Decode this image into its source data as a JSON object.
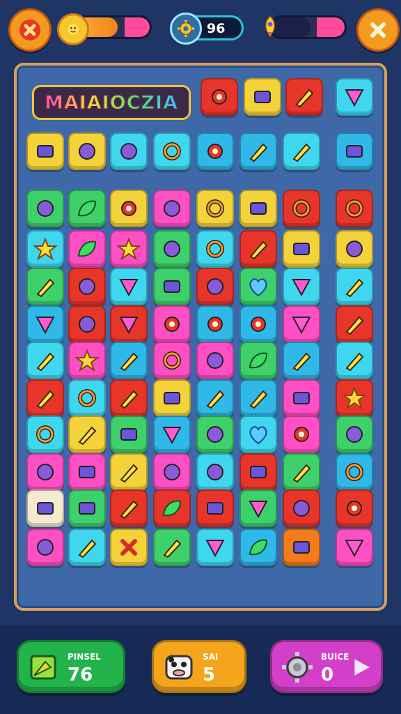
{
  "header": {
    "close_left_icon": "close-icon",
    "close_right_icon": "close-icon",
    "progress_fraction": 0.62,
    "energy_fraction": 0.55,
    "counter_value": "96",
    "colors": {
      "orange": "#f39a1f",
      "pink": "#ff4b9a",
      "teal": "#29c7d8"
    }
  },
  "board": {
    "logo_text": "MAIAIOCZIA"
  },
  "bottom": {
    "left": {
      "label": "PINSEL",
      "value": "76",
      "color": "#22b34a"
    },
    "middle": {
      "label": "SAI",
      "value": "5",
      "color": "#f4a51c"
    },
    "right": {
      "label": "BUICE",
      "value": "0",
      "color": "#d43fc9"
    }
  },
  "tiles": [
    "bug",
    "scroll",
    "red-tube",
    "gem",
    "robot",
    "face",
    "blob",
    "no-sign",
    "gear",
    "wand",
    "pencil",
    "bag",
    "ball",
    "leaf",
    "flower",
    "lolly",
    "swirl",
    "bucket",
    "no-sign",
    "donut",
    "star",
    "pepper",
    "star",
    "ring",
    "squiggle",
    "crayon",
    "box",
    "ring",
    "eraser",
    "ring",
    "pin",
    "m-shape",
    "blob",
    "heart",
    "pin",
    "key",
    "cheese",
    "ring",
    "flag",
    "dots",
    "dots",
    "gear",
    "gem",
    "tube",
    "pencil",
    "star",
    "marker",
    "cc",
    "coin",
    "check",
    "plane",
    "tube",
    "eraser",
    "donut",
    "brush",
    "card",
    "hammer",
    "pencil",
    "chart",
    "star",
    "twist",
    "lipstick",
    "card",
    "triangle",
    "blob",
    "heart",
    "flower",
    "ring",
    "balloon",
    "bag",
    "marker",
    "coin",
    "cloud",
    "card",
    "pencil",
    "spiral",
    "bag",
    "tablet",
    "pencil",
    "leaf",
    "card",
    "triangle",
    "palm",
    "dots",
    "palm",
    "tube",
    "cross",
    "eraser",
    "bell",
    "check",
    "box",
    "cone"
  ]
}
